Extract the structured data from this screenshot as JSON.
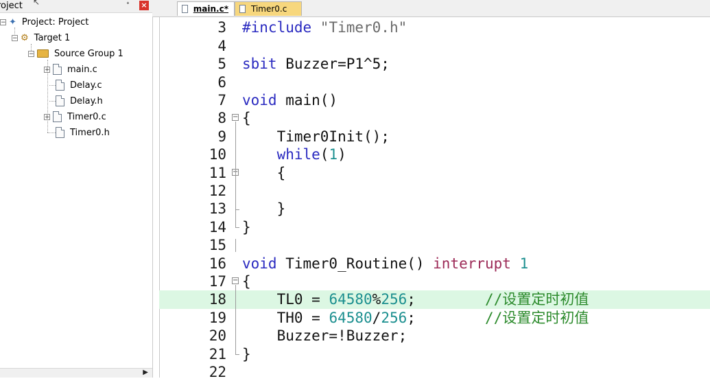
{
  "project_panel": {
    "title": "roject",
    "pin_icon": "pin-icon",
    "close_icon": "close-icon",
    "tree": {
      "project": "Project: Project",
      "target": "Target 1",
      "group": "Source Group 1",
      "files": [
        "main.c",
        "Delay.c",
        "Delay.h",
        "Timer0.c",
        "Timer0.h"
      ]
    }
  },
  "tabs": [
    {
      "label": "main.c*",
      "active": true
    },
    {
      "label": "Timer0.c",
      "active": false
    }
  ],
  "colors": {
    "keyword": "#2a2ac0",
    "number": "#1b8f8f",
    "comment": "#2b8a2b",
    "interrupt": "#9c2a57",
    "highlight": "#dcf7e3",
    "tab_inactive": "#f7d77d"
  },
  "editor": {
    "highlighted_line": 18,
    "lines": [
      {
        "num": "3",
        "tokens": [
          {
            "t": "#include ",
            "c": "pp"
          },
          {
            "t": "\"Timer0.h\"",
            "c": "str"
          }
        ]
      },
      {
        "num": "4",
        "tokens": []
      },
      {
        "num": "5",
        "tokens": [
          {
            "t": "sbit",
            "c": "kw"
          },
          {
            "t": " Buzzer=P1^5;",
            "c": ""
          }
        ]
      },
      {
        "num": "6",
        "tokens": []
      },
      {
        "num": "7",
        "tokens": [
          {
            "t": "void",
            "c": "kw"
          },
          {
            "t": " main()",
            "c": ""
          }
        ]
      },
      {
        "num": "8",
        "tokens": [
          {
            "t": "{",
            "c": ""
          }
        ]
      },
      {
        "num": "9",
        "tokens": [
          {
            "t": "    Timer0Init();",
            "c": ""
          }
        ]
      },
      {
        "num": "10",
        "tokens": [
          {
            "t": "    ",
            "c": ""
          },
          {
            "t": "while",
            "c": "kw"
          },
          {
            "t": "(",
            "c": ""
          },
          {
            "t": "1",
            "c": "num"
          },
          {
            "t": ")",
            "c": ""
          }
        ]
      },
      {
        "num": "11",
        "tokens": [
          {
            "t": "    {",
            "c": ""
          }
        ]
      },
      {
        "num": "12",
        "tokens": []
      },
      {
        "num": "13",
        "tokens": [
          {
            "t": "    }",
            "c": ""
          }
        ]
      },
      {
        "num": "14",
        "tokens": [
          {
            "t": "}",
            "c": ""
          }
        ]
      },
      {
        "num": "15",
        "tokens": []
      },
      {
        "num": "16",
        "tokens": [
          {
            "t": "void",
            "c": "kw"
          },
          {
            "t": " Timer0_Routine() ",
            "c": ""
          },
          {
            "t": "interrupt",
            "c": "intr"
          },
          {
            "t": " ",
            "c": ""
          },
          {
            "t": "1",
            "c": "num"
          }
        ]
      },
      {
        "num": "17",
        "tokens": [
          {
            "t": "{",
            "c": ""
          }
        ]
      },
      {
        "num": "18",
        "tokens": [
          {
            "t": "    TL0 = ",
            "c": ""
          },
          {
            "t": "64580",
            "c": "num"
          },
          {
            "t": "%",
            "c": ""
          },
          {
            "t": "256",
            "c": "num"
          },
          {
            "t": ";        ",
            "c": ""
          },
          {
            "t": "//设置定时初值",
            "c": "cmt"
          }
        ]
      },
      {
        "num": "19",
        "tokens": [
          {
            "t": "    TH0 = ",
            "c": ""
          },
          {
            "t": "64580",
            "c": "num"
          },
          {
            "t": "/",
            "c": ""
          },
          {
            "t": "256",
            "c": "num"
          },
          {
            "t": ";        ",
            "c": ""
          },
          {
            "t": "//设置定时初值",
            "c": "cmt"
          }
        ]
      },
      {
        "num": "20",
        "tokens": [
          {
            "t": "    Buzzer=!Buzzer;",
            "c": ""
          }
        ]
      },
      {
        "num": "21",
        "tokens": [
          {
            "t": "}",
            "c": ""
          }
        ]
      },
      {
        "num": "22",
        "tokens": []
      }
    ]
  }
}
